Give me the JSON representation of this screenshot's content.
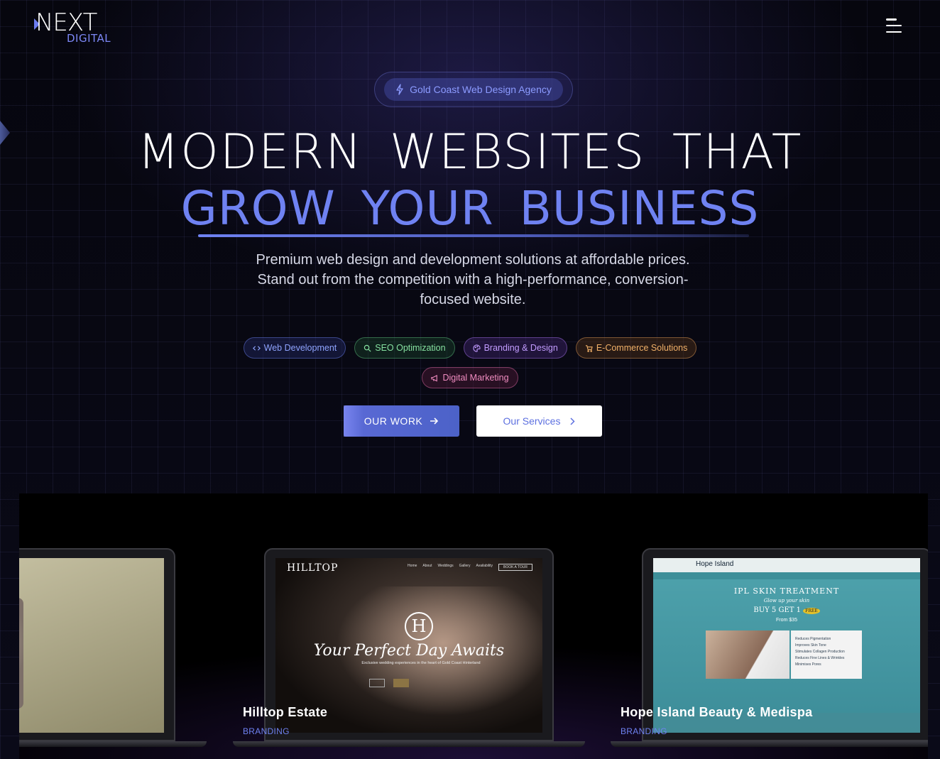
{
  "header": {
    "logo": {
      "word": "NEXT",
      "sub": "DIGITAL"
    },
    "menu_icon": "hamburger-menu-icon"
  },
  "hero": {
    "badge": "Gold Coast Web Design Agency",
    "title_line1": "MODERN WEBSITES THAT",
    "title_line2": "GROW YOUR BUSINESS",
    "lead": "Premium web design and development solutions at affordable prices. Stand out from the competition with a high-performance, conversion-focused website.",
    "pills": [
      {
        "label": "Web Development",
        "icon": "code-icon",
        "color": "#8fa4ff"
      },
      {
        "label": "SEO Optimization",
        "icon": "search-icon",
        "color": "#86e0a0"
      },
      {
        "label": "Branding & Design",
        "icon": "palette-icon",
        "color": "#c29cff"
      },
      {
        "label": "E-Commerce Solutions",
        "icon": "cart-icon",
        "color": "#f0b068"
      },
      {
        "label": "Digital Marketing",
        "icon": "megaphone-icon",
        "color": "#f08cc0"
      }
    ],
    "cta_primary": "OUR WORK",
    "cta_secondary": "Our Services"
  },
  "portfolio": {
    "items": [
      {
        "title": "",
        "category": ""
      },
      {
        "title": "Hilltop Estate",
        "category": "BRANDING",
        "screen": {
          "logo": "HILLTOP",
          "nav": [
            "Home",
            "About",
            "Weddings",
            "Gallery",
            "Availability",
            "BOOK A TOUR"
          ],
          "headline": "Your Perfect Day Awaits",
          "sub": "Exclusive wedding experiences in the heart of Gold Coast Hinterland",
          "emblem": "H"
        }
      },
      {
        "title": "Hope Island Beauty & Medispa",
        "category": "BRANDING",
        "screen": {
          "logo": "Hope Island",
          "heading": "IPL SKIN TREATMENT",
          "tagline": "Glow up your skin",
          "offer": "BUY 5 GET 1",
          "offer_badge": "FREE",
          "price": "From $35",
          "benefits": [
            "Reduces Pigmentation",
            "Improves Skin Tone",
            "Stimulates Collagen Production",
            "Reduces Fine Lines & Wrinkles",
            "Minimises Pores"
          ]
        }
      }
    ]
  },
  "colors": {
    "accent": "#6f82f2",
    "background": "#05050c"
  }
}
